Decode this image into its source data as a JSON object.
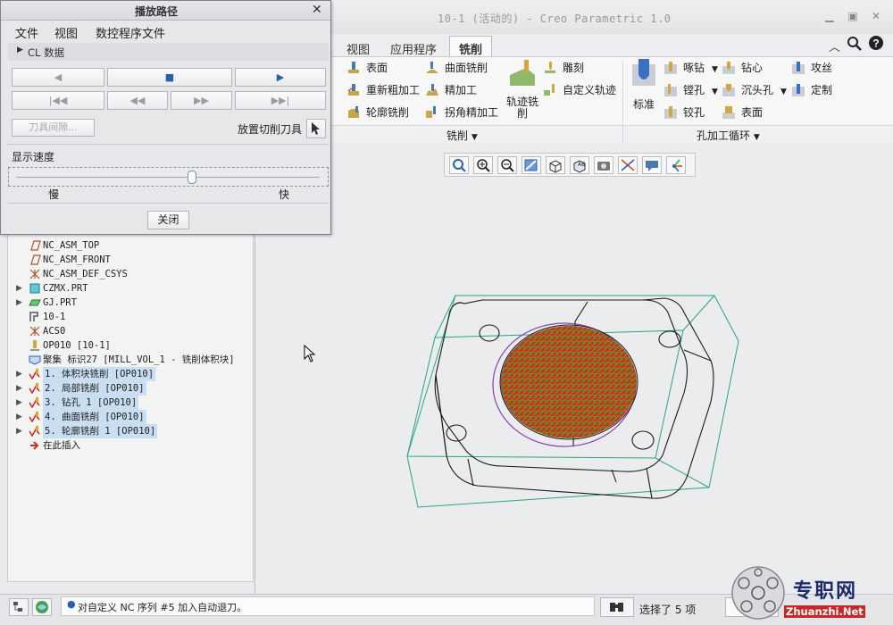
{
  "window": {
    "title": "10-1 (活动的) - Creo Parametric 1.0"
  },
  "ribbon": {
    "tabs": [
      "视图",
      "应用程序",
      "铣削"
    ],
    "active_tab": "铣削",
    "mill_group": {
      "label": "铣削",
      "items": [
        "表面",
        "重新粗加工",
        "轮廓铣削",
        "曲面铣削",
        "精加工",
        "拐角精加工",
        "轨迹铣削",
        "雕刻",
        "自定义轨迹"
      ]
    },
    "hole_group": {
      "label": "孔加工循环",
      "standard": "标准",
      "items": [
        "啄钻",
        "镗孔",
        "铰孔",
        "钻心",
        "沉头孔",
        "表面",
        "攻丝",
        "定制"
      ]
    }
  },
  "dialog": {
    "title": "播放路径",
    "menu": [
      "文件",
      "视图",
      "数控程序文件"
    ],
    "cl_section": "CL 数据",
    "tool_clearance": "刀具间隙...",
    "place_cutter": "放置切削刀具",
    "speed_label": "显示速度",
    "slow": "慢",
    "fast": "快",
    "speed_value": 0.58,
    "close": "关闭"
  },
  "tree": {
    "items": [
      {
        "text": "NC_ASM_TOP",
        "icon": "datum-plane-icon",
        "highlight": false
      },
      {
        "text": "NC_ASM_FRONT",
        "icon": "datum-plane-icon",
        "highlight": false
      },
      {
        "text": "NC_ASM_DEF_CSYS",
        "icon": "csys-icon",
        "highlight": false
      },
      {
        "text": "CZMX.PRT",
        "icon": "part-icon",
        "highlight": false
      },
      {
        "text": "GJ.PRT",
        "icon": "part-icon",
        "highlight": false
      },
      {
        "text": "10-1",
        "icon": "workcell-icon",
        "highlight": false
      },
      {
        "text": "ACS0",
        "icon": "csys-icon",
        "highlight": false
      },
      {
        "text": "OP010 [10-1]",
        "icon": "operation-icon",
        "highlight": false
      },
      {
        "text": "聚集 标识27 [MILL_VOL_1 - 铣削体积块]",
        "icon": "mill-volume-icon",
        "highlight": false
      },
      {
        "text": "1. 体积块铣削 [OP010]",
        "icon": "nc-sequence-icon",
        "highlight": true
      },
      {
        "text": "2. 局部铣削 [OP010]",
        "icon": "nc-sequence-icon",
        "highlight": true
      },
      {
        "text": "3. 钻孔 1 [OP010]",
        "icon": "nc-sequence-icon",
        "highlight": true
      },
      {
        "text": "4. 曲面铣削 [OP010]",
        "icon": "nc-sequence-icon",
        "highlight": true
      },
      {
        "text": "5. 轮廓铣削 1 [OP010]",
        "icon": "nc-sequence-icon",
        "highlight": true
      },
      {
        "text": "在此插入",
        "icon": "insert-here-icon",
        "highlight": false
      }
    ]
  },
  "status": {
    "message": "对自定义 NC 序列 #5 加入自动退刀。",
    "selection": "选择了 5 项"
  },
  "watermark": {
    "text": "专职网",
    "url": "Zhuanzhi.Net"
  },
  "colors": {
    "highlight": "#c9def0",
    "toolpath_red": "#c8321e",
    "toolpath_green": "#52a82c",
    "stock_green": "#2aa57f",
    "tool_purple": "#8a3fb8"
  }
}
